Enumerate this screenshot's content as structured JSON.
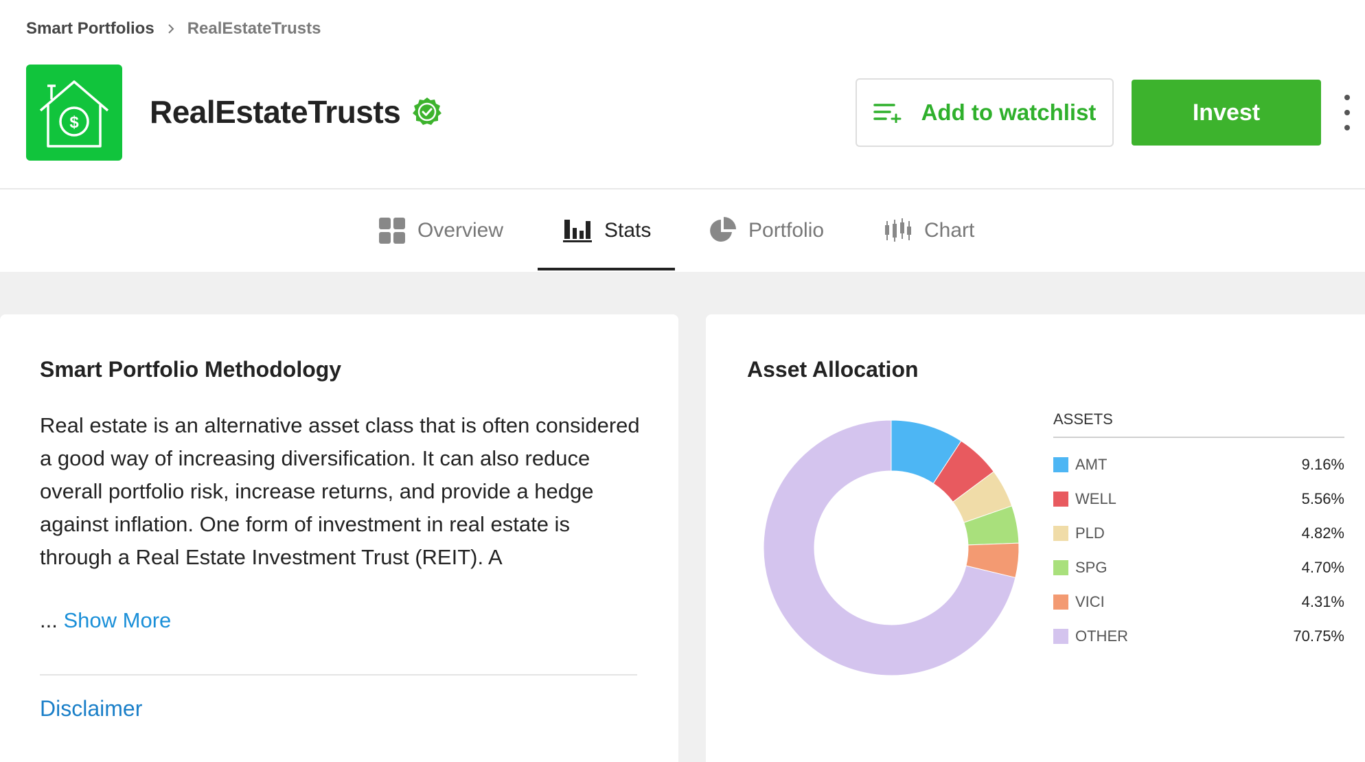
{
  "breadcrumb": {
    "root": "Smart Portfolios",
    "current": "RealEstateTrusts"
  },
  "header": {
    "title": "RealEstateTrusts",
    "watchlist_label": "Add to watchlist",
    "invest_label": "Invest"
  },
  "tabs": [
    {
      "label": "Overview",
      "icon": "grid-icon",
      "active": false
    },
    {
      "label": "Stats",
      "icon": "bar-chart-icon",
      "active": true
    },
    {
      "label": "Portfolio",
      "icon": "pie-chart-icon",
      "active": false
    },
    {
      "label": "Chart",
      "icon": "candlestick-icon",
      "active": false
    }
  ],
  "methodology": {
    "title": "Smart Portfolio Methodology",
    "text": "Real estate is an alternative asset class that is often considered a good way of increasing diversification. It can also reduce overall portfolio risk, increase returns, and provide a hedge against inflation. One form of investment in real estate is through a Real Estate Investment Trust (REIT). A",
    "ellipsis": "...",
    "show_more": "Show More",
    "disclaimer": "Disclaimer"
  },
  "allocation": {
    "title": "Asset Allocation",
    "legend_header": "ASSETS"
  },
  "colors": {
    "brand_green": "#3db32d",
    "logo_green": "#11c43c",
    "link_blue": "#1a8fd8"
  },
  "chart_data": {
    "type": "pie",
    "categories": [
      "AMT",
      "WELL",
      "PLD",
      "SPG",
      "VICI",
      "OTHER"
    ],
    "values": [
      9.16,
      5.56,
      4.82,
      4.7,
      4.31,
      70.75
    ],
    "labels": [
      "9.16%",
      "5.56%",
      "4.82%",
      "4.70%",
      "4.31%",
      "70.75%"
    ],
    "colors": [
      "#4db6f4",
      "#e85a5f",
      "#f0dca8",
      "#a9e07c",
      "#f39a72",
      "#d4c4ee"
    ],
    "donut": true,
    "legend": "right"
  }
}
